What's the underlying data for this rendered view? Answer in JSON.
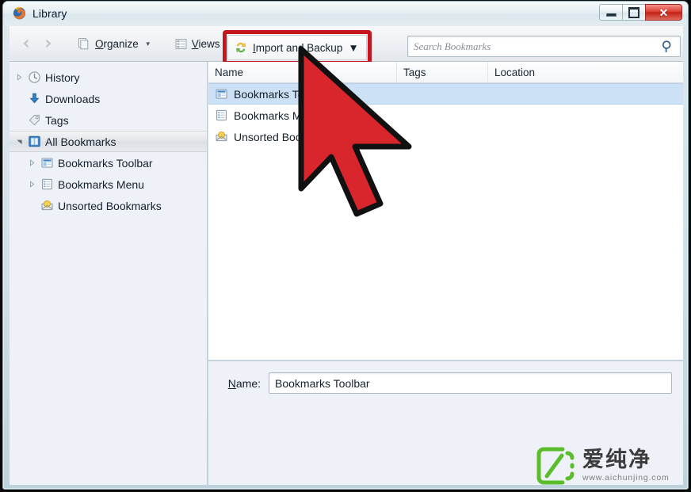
{
  "window": {
    "title": "Library",
    "app_icon": "firefox-icon",
    "controls": {
      "minimize": "minimize-icon",
      "maximize": "restore-icon",
      "close": "✕"
    }
  },
  "toolbar": {
    "back": "back-arrow-icon",
    "forward": "forward-arrow-icon",
    "organize_label": "Organize",
    "organize_accel": "O",
    "views_label": "Views",
    "views_accel": "V",
    "import_label": "Import and Backup",
    "import_accel": "I",
    "caret": "▾",
    "highlight_color": "#c4161c"
  },
  "search": {
    "placeholder": "Search Bookmarks",
    "value": "",
    "icon": "search-icon"
  },
  "sidebar": {
    "items": [
      {
        "label": "History",
        "icon": "clock-icon",
        "twisty": "collapsed",
        "indent": 0,
        "selected": false
      },
      {
        "label": "Downloads",
        "icon": "download-arrow-icon",
        "twisty": "none",
        "indent": 0,
        "selected": false
      },
      {
        "label": "Tags",
        "icon": "tag-icon",
        "twisty": "none",
        "indent": 0,
        "selected": false
      },
      {
        "label": "All Bookmarks",
        "icon": "bookmarks-icon",
        "twisty": "expanded",
        "indent": 0,
        "selected": true
      },
      {
        "label": "Bookmarks Toolbar",
        "icon": "toolbar-folder-icon",
        "twisty": "collapsed",
        "indent": 1,
        "selected": false
      },
      {
        "label": "Bookmarks Menu",
        "icon": "menu-folder-icon",
        "twisty": "collapsed",
        "indent": 1,
        "selected": false
      },
      {
        "label": "Unsorted Bookmarks",
        "icon": "unsorted-folder-icon",
        "twisty": "none",
        "indent": 1,
        "selected": false
      }
    ]
  },
  "list": {
    "columns": [
      "Name",
      "Tags",
      "Location"
    ],
    "rows": [
      {
        "name": "Bookmarks Toolbar",
        "tags": "",
        "location": "",
        "icon": "toolbar-folder-icon",
        "selected": true
      },
      {
        "name": "Bookmarks Menu",
        "tags": "",
        "location": "",
        "icon": "menu-folder-icon",
        "selected": false
      },
      {
        "name": "Unsorted Bookmarks",
        "tags": "",
        "location": "",
        "icon": "unsorted-folder-icon",
        "selected": false
      }
    ]
  },
  "details": {
    "name_label": "Name:",
    "name_accel": "N",
    "name_value": "Bookmarks Toolbar"
  },
  "watermark": {
    "text_cn": "爱纯净",
    "url": "www.aichunjing.com",
    "logo_color": "#5bbd2c"
  },
  "cursor": {
    "type": "arrow-pointer",
    "color": "#d8262c"
  }
}
